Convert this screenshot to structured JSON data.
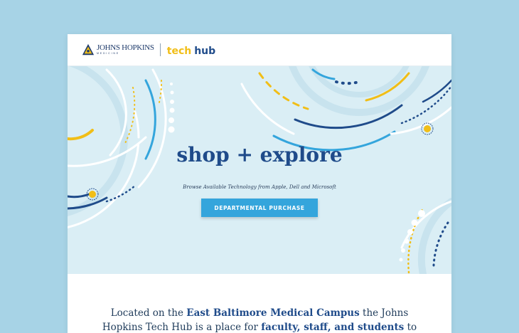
{
  "header": {
    "jh_name": "JOHNS HOPKINS",
    "jh_sub": "MEDICINE",
    "brand_tech": "tech",
    "brand_hub": "hub"
  },
  "hero": {
    "title": "shop + explore",
    "subtitle": "Browse Available Technology from Apple, Dell and Microsoft",
    "cta_label": "DEPARTMENTAL PURCHASE"
  },
  "intro": {
    "line1_a": "Located on the ",
    "line1_b": "East Baltimore Medical Campus",
    "line1_c": " the Johns",
    "line2_a": "Hopkins Tech Hub is a place for ",
    "line2_b": "faculty, staff, and students",
    "line2_c": " to purchase"
  },
  "colors": {
    "page_bg": "#a7d3e6",
    "hero_bg": "#daeef5",
    "navy": "#1f4b8a",
    "blue": "#34a5dc",
    "yellow": "#f1be17"
  },
  "icons": [
    "johns-hopkins-shield-icon"
  ]
}
